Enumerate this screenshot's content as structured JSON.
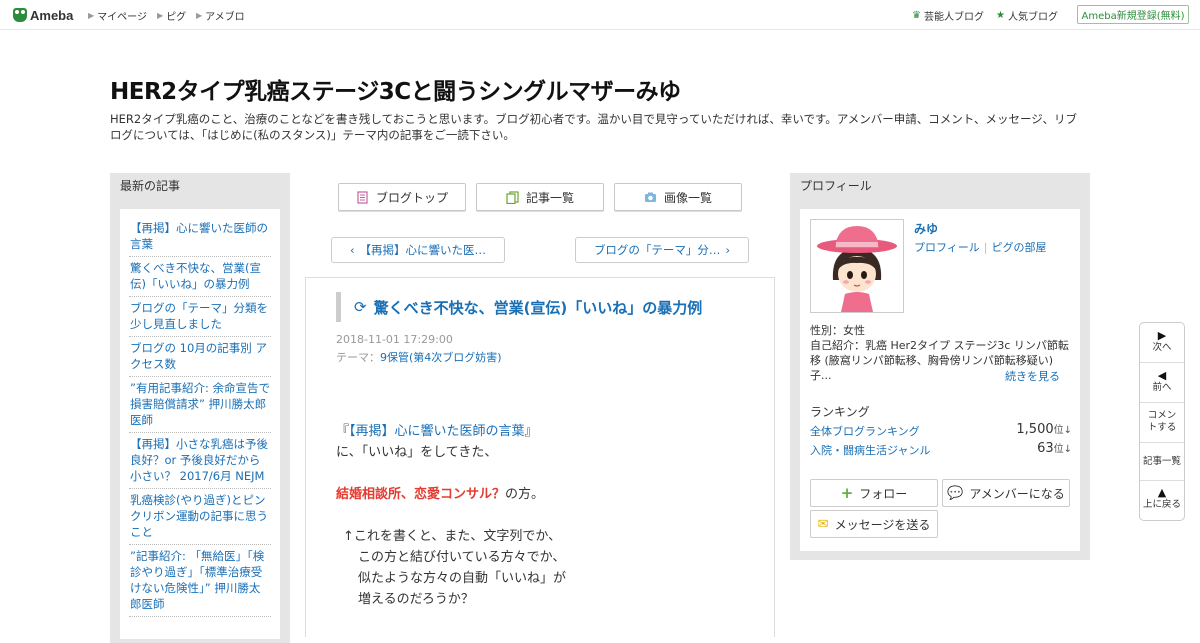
{
  "topbar": {
    "logo_text": "Ameba",
    "nav": [
      "マイページ",
      "ピグ",
      "アメブロ"
    ],
    "right_links": [
      {
        "label": "芸能人ブログ",
        "icon": "crown-icon"
      },
      {
        "label": "人気ブログ",
        "icon": "star-icon"
      }
    ],
    "register_label": "Ameba新規登録(無料)"
  },
  "blog": {
    "title": "HER2タイプ乳癌ステージ3Cと闘うシングルマザーみゆ",
    "description": "HER2タイプ乳癌のこと、治療のことなどを書き残しておこうと思います。ブログ初心者です。温かい目で見守っていただければ、幸いです。アメンバー申請、コメント、メッセージ、リブログについては、「はじめに(私のスタンス)」テーマ内の記事をご一読下さい。"
  },
  "left_sidebar": {
    "heading": "最新の記事",
    "items": [
      "【再掲】心に響いた医師の言葉",
      "驚くべき不快な、営業(宣伝)「いいね」の暴力例",
      "ブログの「テーマ」分類を少し見直しました",
      "ブログの 10月の記事別 アクセス数",
      "”有用記事紹介: 余命宣告で損害賠償請求” 押川勝太郎医師",
      "【再掲】小さな乳癌は予後良好？or 予後良好だから小さい？ 2017/6月 NEJM",
      "乳癌検診(やり過ぎ)とピンクリボン運動の記事に思うこと",
      "”記事紹介: 「無給医」「検診やり過ぎ」「標準治療受けない危険性」” 押川勝太郎医師"
    ]
  },
  "center": {
    "top_buttons": [
      {
        "label": "ブログトップ",
        "icon": "document-icon"
      },
      {
        "label": "記事一覧",
        "icon": "list-icon"
      },
      {
        "label": "画像一覧",
        "icon": "camera-icon"
      }
    ],
    "prev_label": "【再掲】心に響いた医…",
    "next_label": "ブログの「テーマ」分…",
    "article": {
      "title": "驚くべき不快な、営業(宣伝)「いいね」の暴力例",
      "date": "2018-11-01 17:29:00",
      "theme_prefix": "テーマ：",
      "theme": "9保管(第4次ブログ妨害)",
      "line1_open": "『",
      "line1_link": "【再掲】心に響いた医師の言葉",
      "line1_close": "』",
      "line2": "に、「いいね」をしてきた、",
      "line3_red": "結婚相談所、恋愛コンサル？",
      "line3_rest": "の方。",
      "line4": "↑これを書くと、また、文字列でか、",
      "line5": "この方と結び付いている方々でか、",
      "line6": "似たような方々の自動「いいね」が",
      "line7": "増えるのだろうか？"
    }
  },
  "profile": {
    "heading": "プロフィール",
    "name": "みゆ",
    "link_profile": "プロフィール",
    "link_pig": "ピグの部屋",
    "gender": "性別：女性",
    "intro": "自己紹介：乳癌 Her2タイプ ステージ3c リンパ節転移 (腋窩リンパ節転移、胸骨傍リンパ節転移疑い) 子...",
    "more": "続きを見る",
    "ranking_heading": "ランキング",
    "rankings": [
      {
        "label": "全体ブログランキング",
        "value": "1,500",
        "unit": "位",
        "trend": "↓"
      },
      {
        "label": "入院・闘病生活ジャンル",
        "value": "63",
        "unit": "位",
        "trend": "↓"
      }
    ],
    "follow_label": "フォロー",
    "amember_label": "アメンバーになる",
    "message_label": "メッセージを送る",
    "colors": {
      "accent_green": "#2d8c3c",
      "link_blue": "#1a6fb5",
      "red_text": "#e53a2f"
    }
  },
  "float_nav": {
    "next": "次へ",
    "prev": "前へ",
    "comment": "コメントする",
    "list": "記事一覧",
    "top": "上に戻る"
  }
}
